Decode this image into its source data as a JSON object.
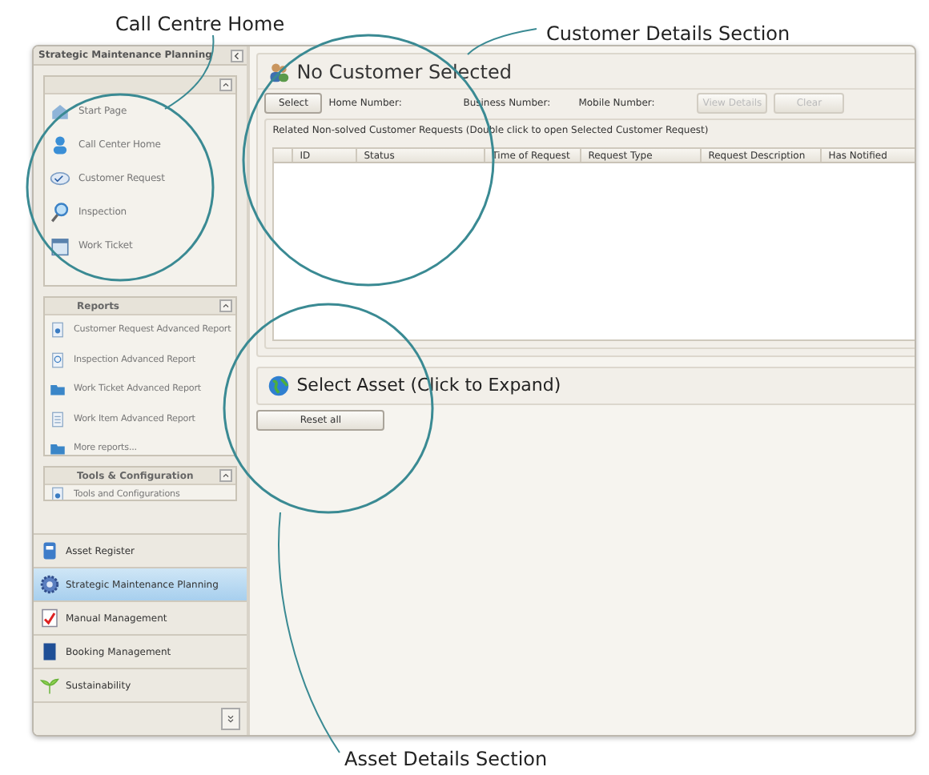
{
  "annotations": [
    {
      "text": "Call Centre Home"
    },
    {
      "text": "Customer Details Section"
    },
    {
      "text": "Asset Details Section"
    }
  ],
  "sidebar": {
    "title": "Strategic Maintenance Planning",
    "groups": [
      {
        "items": [
          {
            "label": "Start Page"
          },
          {
            "label": "Call Center Home"
          },
          {
            "label": "Customer Request"
          },
          {
            "label": "Inspection"
          },
          {
            "label": "Work Ticket"
          }
        ]
      },
      {
        "title": "Reports",
        "items": [
          {
            "label": "Customer Request Advanced Report"
          },
          {
            "label": "Inspection Advanced Report"
          },
          {
            "label": "Work Ticket Advanced Report"
          },
          {
            "label": "Work Item Advanced Report"
          },
          {
            "label": "More reports..."
          }
        ]
      },
      {
        "title": "Tools & Configuration",
        "items": [
          {
            "label": "Tools and Configurations"
          }
        ]
      }
    ],
    "modules": [
      {
        "label": "Asset Register",
        "selected": false
      },
      {
        "label": "Strategic Maintenance Planning",
        "selected": true
      },
      {
        "label": "Manual Management",
        "selected": false
      },
      {
        "label": "Booking Management",
        "selected": false
      },
      {
        "label": "Sustainability",
        "selected": false
      }
    ]
  },
  "customer": {
    "title": "No Customer Selected",
    "select_button": "Select",
    "fields": [
      {
        "label": "Home Number:"
      },
      {
        "label": "Business Number:"
      },
      {
        "label": "Mobile Number:"
      }
    ],
    "buttons": [
      {
        "label": "View Details",
        "disabled": true
      },
      {
        "label": "Clear",
        "disabled": true
      }
    ],
    "requests_caption": "Related Non-solved Customer Requests (Double click to open Selected Customer Request)",
    "table": {
      "columns": [
        "ID",
        "Status",
        "Time of Request",
        "Request Type",
        "Request Description",
        "Has Notified"
      ]
    }
  },
  "asset": {
    "title": "Select Asset (Click to Expand)",
    "reset_button": "Reset all"
  }
}
